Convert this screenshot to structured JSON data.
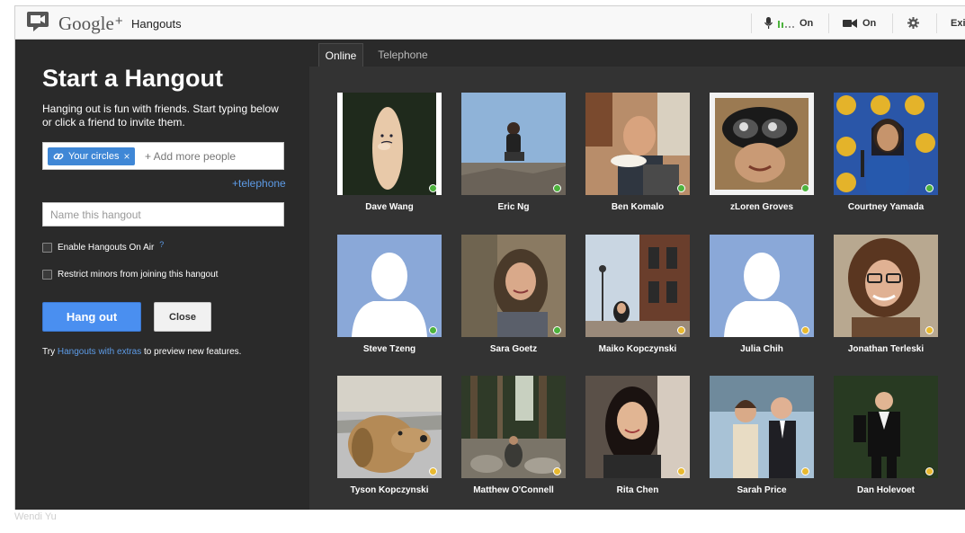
{
  "header": {
    "brand": "Google",
    "brand_plus": "+",
    "product": "Hangouts",
    "mic_label": "On",
    "camera_label": "On",
    "exit_label": "Exit",
    "icons": [
      "hangouts-logo-icon",
      "microphone-icon",
      "camera-icon",
      "gear-icon"
    ]
  },
  "left": {
    "title": "Start a Hangout",
    "description": "Hanging out is fun with friends. Start typing below or click a friend to invite them.",
    "chip_label": "Your circles",
    "chip_remove": "×",
    "add_placeholder": "+ Add more people",
    "telephone_link": "+telephone",
    "name_placeholder": "Name this hangout",
    "checkbox_onair": "Enable Hangouts On Air",
    "checkbox_onair_help": "?",
    "checkbox_minors": "Restrict minors from joining this hangout",
    "hangout_button": "Hang out",
    "close_button": "Close",
    "footnote_prefix": "Try ",
    "footnote_link": "Hangouts with extras",
    "footnote_suffix": " to preview new features."
  },
  "tabs": {
    "online": "Online",
    "telephone": "Telephone"
  },
  "people": [
    {
      "name": "Dave Wang",
      "status": "green"
    },
    {
      "name": "Eric Ng",
      "status": "green"
    },
    {
      "name": "Ben Komalo",
      "status": "green"
    },
    {
      "name": "zLoren Groves",
      "status": "green"
    },
    {
      "name": "Courtney Yamada",
      "status": "green"
    },
    {
      "name": "Steve Tzeng",
      "status": "green"
    },
    {
      "name": "Sara Goetz",
      "status": "green"
    },
    {
      "name": "Maiko Kopczynski",
      "status": "yellow"
    },
    {
      "name": "Julia Chih",
      "status": "yellow"
    },
    {
      "name": "Jonathan Terleski",
      "status": "yellow"
    },
    {
      "name": "Tyson Kopczynski",
      "status": "yellow"
    },
    {
      "name": "Matthew O'Connell",
      "status": "yellow"
    },
    {
      "name": "Rita Chen",
      "status": "yellow"
    },
    {
      "name": "Sarah Price",
      "status": "yellow"
    },
    {
      "name": "Dan Holevoet",
      "status": "yellow"
    }
  ],
  "watermark": "Wendi Yu",
  "colors": {
    "accent_blue": "#4a8ff0",
    "link_blue": "#5d9be6",
    "online_green": "#4db33d",
    "idle_yellow": "#e8b930",
    "panel_dark": "#2a2a2a"
  }
}
